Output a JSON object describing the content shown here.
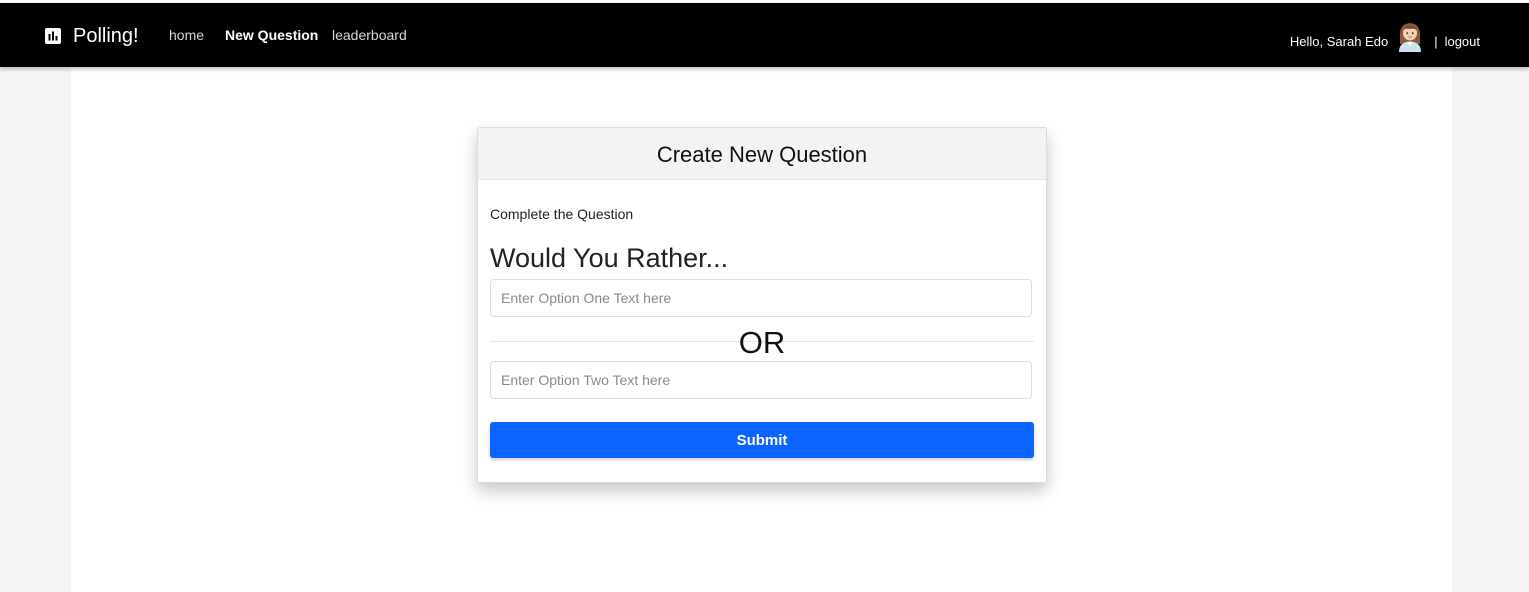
{
  "navbar": {
    "brand": "Polling!",
    "links": [
      {
        "label": "home",
        "active": false
      },
      {
        "label": "New Question",
        "active": true
      },
      {
        "label": "leaderboard",
        "active": false
      }
    ],
    "greeting": "Hello, Sarah Edo",
    "separator": "|",
    "logout_label": "logout",
    "brand_icon": "bar-chart-icon",
    "avatar_icon": "user-avatar-icon"
  },
  "card": {
    "title": "Create New Question",
    "instruction": "Complete the Question",
    "heading": "Would You Rather...",
    "option_one": {
      "value": "",
      "placeholder": "Enter Option One Text here"
    },
    "or_label": "OR",
    "option_two": {
      "value": "",
      "placeholder": "Enter Option Two Text here"
    },
    "submit_label": "Submit"
  },
  "colors": {
    "navbar_bg": "#000000",
    "submit_bg": "#0b64ff",
    "page_bg": "#f4f4f4"
  }
}
